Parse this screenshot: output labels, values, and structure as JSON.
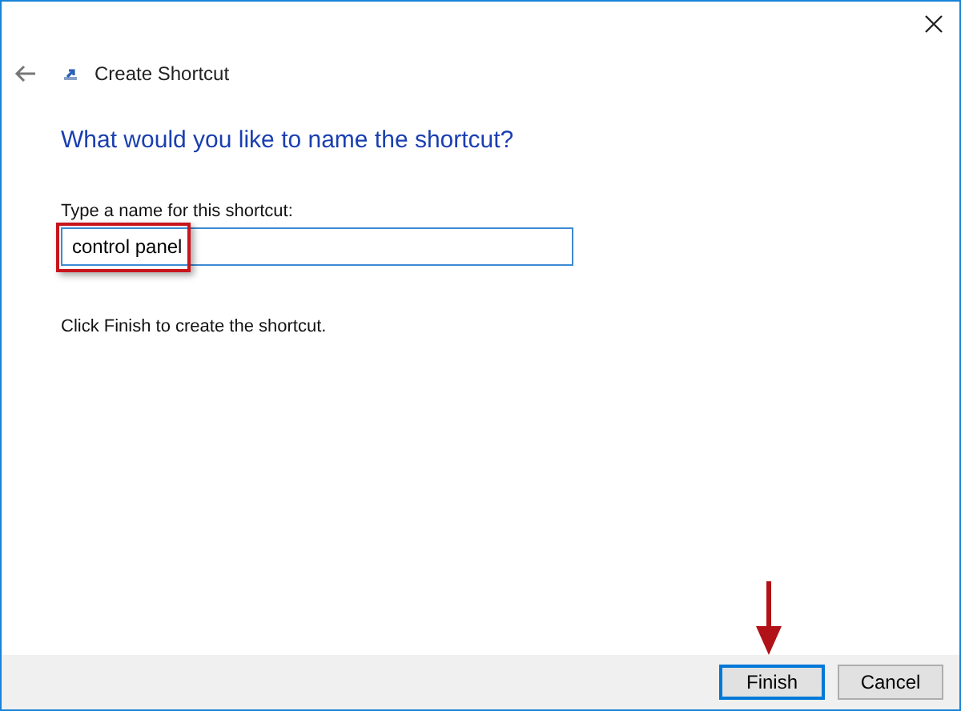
{
  "window": {
    "title": "Create Shortcut"
  },
  "heading": "What would you like to name the shortcut?",
  "name_field": {
    "label": "Type a name for this shortcut:",
    "value": "control panel",
    "highlighted": true
  },
  "instruction": "Click Finish to create the shortcut.",
  "buttons": [
    {
      "label": "Finish",
      "default": true,
      "pointed": true
    },
    {
      "label": "Cancel",
      "default": false,
      "pointed": false
    }
  ]
}
